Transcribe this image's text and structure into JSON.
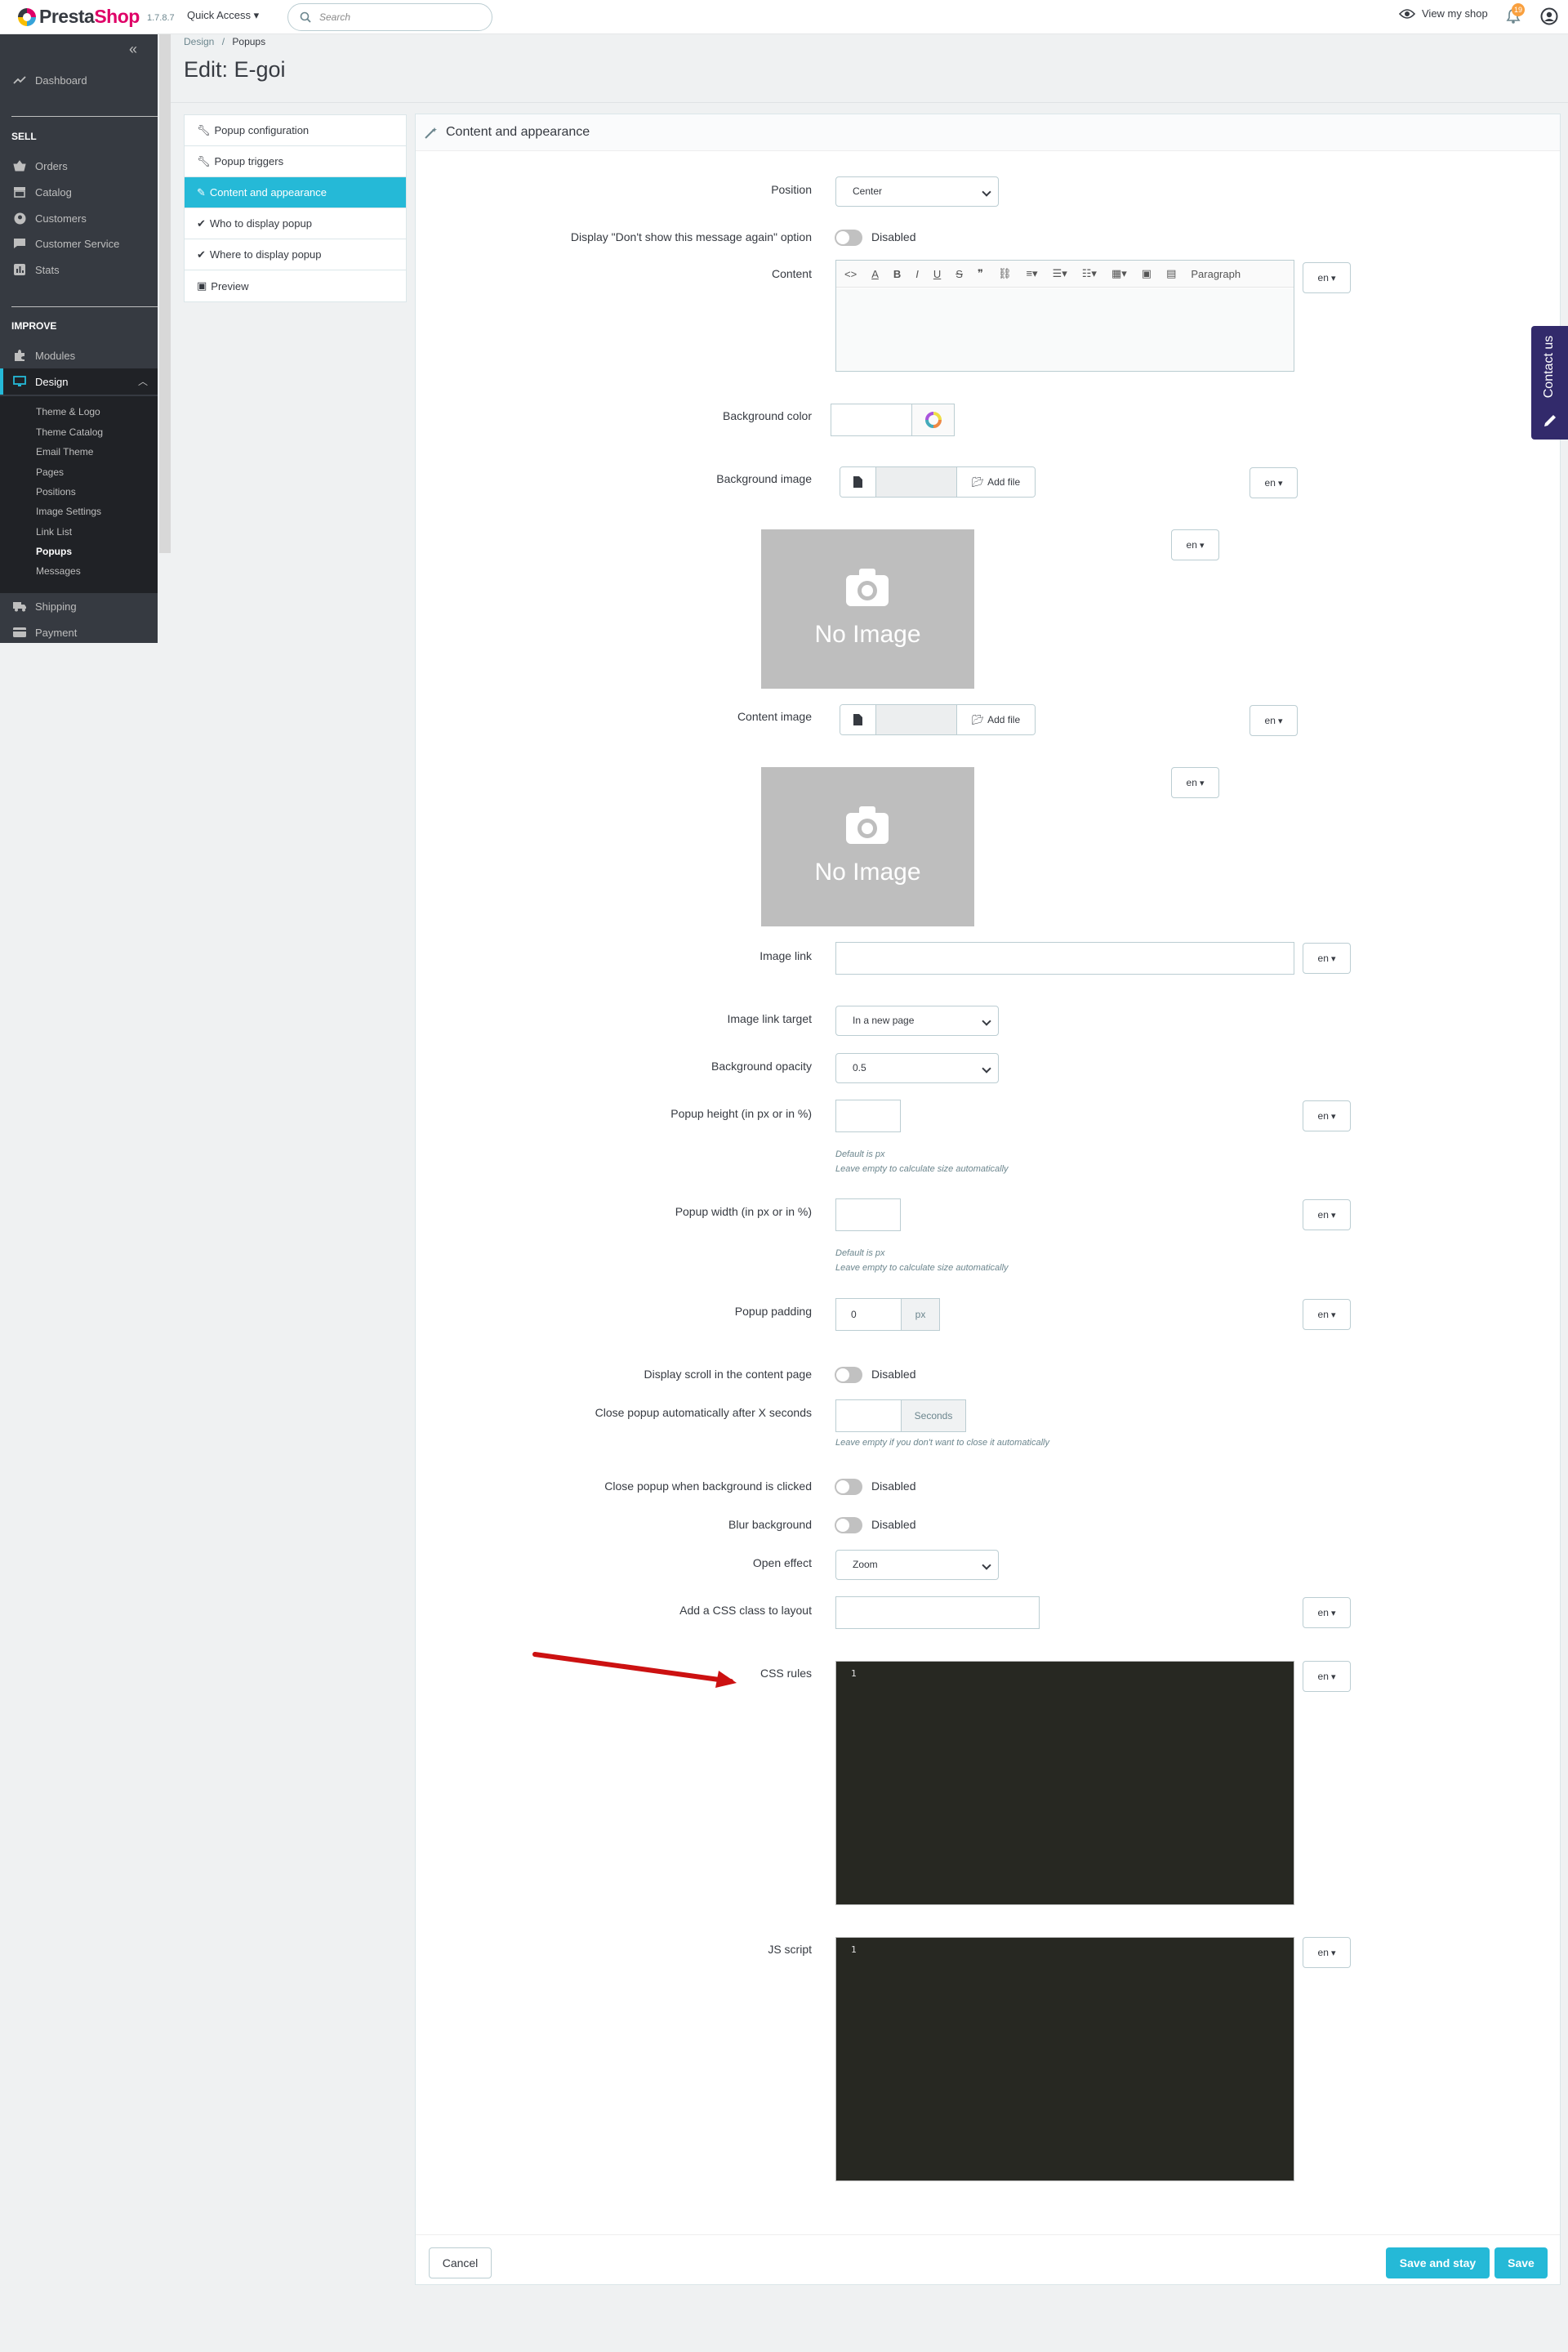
{
  "header": {
    "brand_presta": "Presta",
    "brand_shop": "Shop",
    "version": "1.7.8.7",
    "quick_access": "Quick Access ▾",
    "search_placeholder": "Search",
    "view_shop": "View my shop",
    "notifications_count": "19"
  },
  "sidebar": {
    "dashboard": "Dashboard",
    "sell_title": "SELL",
    "orders": "Orders",
    "catalog": "Catalog",
    "customers": "Customers",
    "customer_service": "Customer Service",
    "stats": "Stats",
    "improve_title": "IMPROVE",
    "modules": "Modules",
    "design": "Design",
    "design_sub": [
      "Theme & Logo",
      "Theme Catalog",
      "Email Theme",
      "Pages",
      "Positions",
      "Image Settings",
      "Link List",
      "Popups",
      "Messages"
    ],
    "shipping": "Shipping",
    "payment": "Payment"
  },
  "page": {
    "breadcrumb_parent": "Design",
    "breadcrumb_sep": "/",
    "breadcrumb_current": "Popups",
    "title": "Edit: E-goi"
  },
  "tabs": [
    {
      "label": "Popup configuration"
    },
    {
      "label": "Popup triggers"
    },
    {
      "label": "Content and appearance"
    },
    {
      "label": "Who to display popup"
    },
    {
      "label": "Where to display popup"
    },
    {
      "label": "Preview"
    }
  ],
  "panel": {
    "title": "Content and appearance"
  },
  "form": {
    "position_label": "Position",
    "position_value": "Center",
    "dont_show_label": "Display \"Don't show this message again\" option",
    "disabled": "Disabled",
    "content_label": "Content",
    "editor_paragraph": "Paragraph",
    "lang": "en",
    "bg_color_label": "Background color",
    "bg_image_label": "Background image",
    "add_file": "Add file",
    "no_image": "No Image",
    "content_image_label": "Content image",
    "image_link_label": "Image link",
    "image_link_target_label": "Image link target",
    "image_link_target_value": "In a new page",
    "bg_opacity_label": "Background opacity",
    "bg_opacity_value": "0.5",
    "popup_height_label": "Popup height (in px or in %)",
    "default_px": "Default is px",
    "leave_empty_size": "Leave empty to calculate size automatically",
    "popup_width_label": "Popup width (in px or in %)",
    "popup_padding_label": "Popup padding",
    "popup_padding_value": "0",
    "px": "px",
    "display_scroll_label": "Display scroll in the content page",
    "close_auto_label": "Close popup automatically after X seconds",
    "seconds": "Seconds",
    "leave_empty_close": "Leave empty if you don't want to close it automatically",
    "close_bg_label": "Close popup when background is clicked",
    "blur_label": "Blur background",
    "open_effect_label": "Open effect",
    "open_effect_value": "Zoom",
    "css_class_label": "Add a CSS class to layout",
    "css_rules_label": "CSS rules",
    "js_script_label": "JS script",
    "line_number": "1"
  },
  "footer": {
    "cancel": "Cancel",
    "save_and_stay": "Save and stay",
    "save": "Save"
  },
  "contact_us": "Contact us",
  "colors": {
    "accent": "#25b9d7",
    "brand_pink": "#df0067",
    "sidebar_bg": "#363a41",
    "contact_bg": "#322a6b",
    "arrow_red": "#cc1111"
  }
}
